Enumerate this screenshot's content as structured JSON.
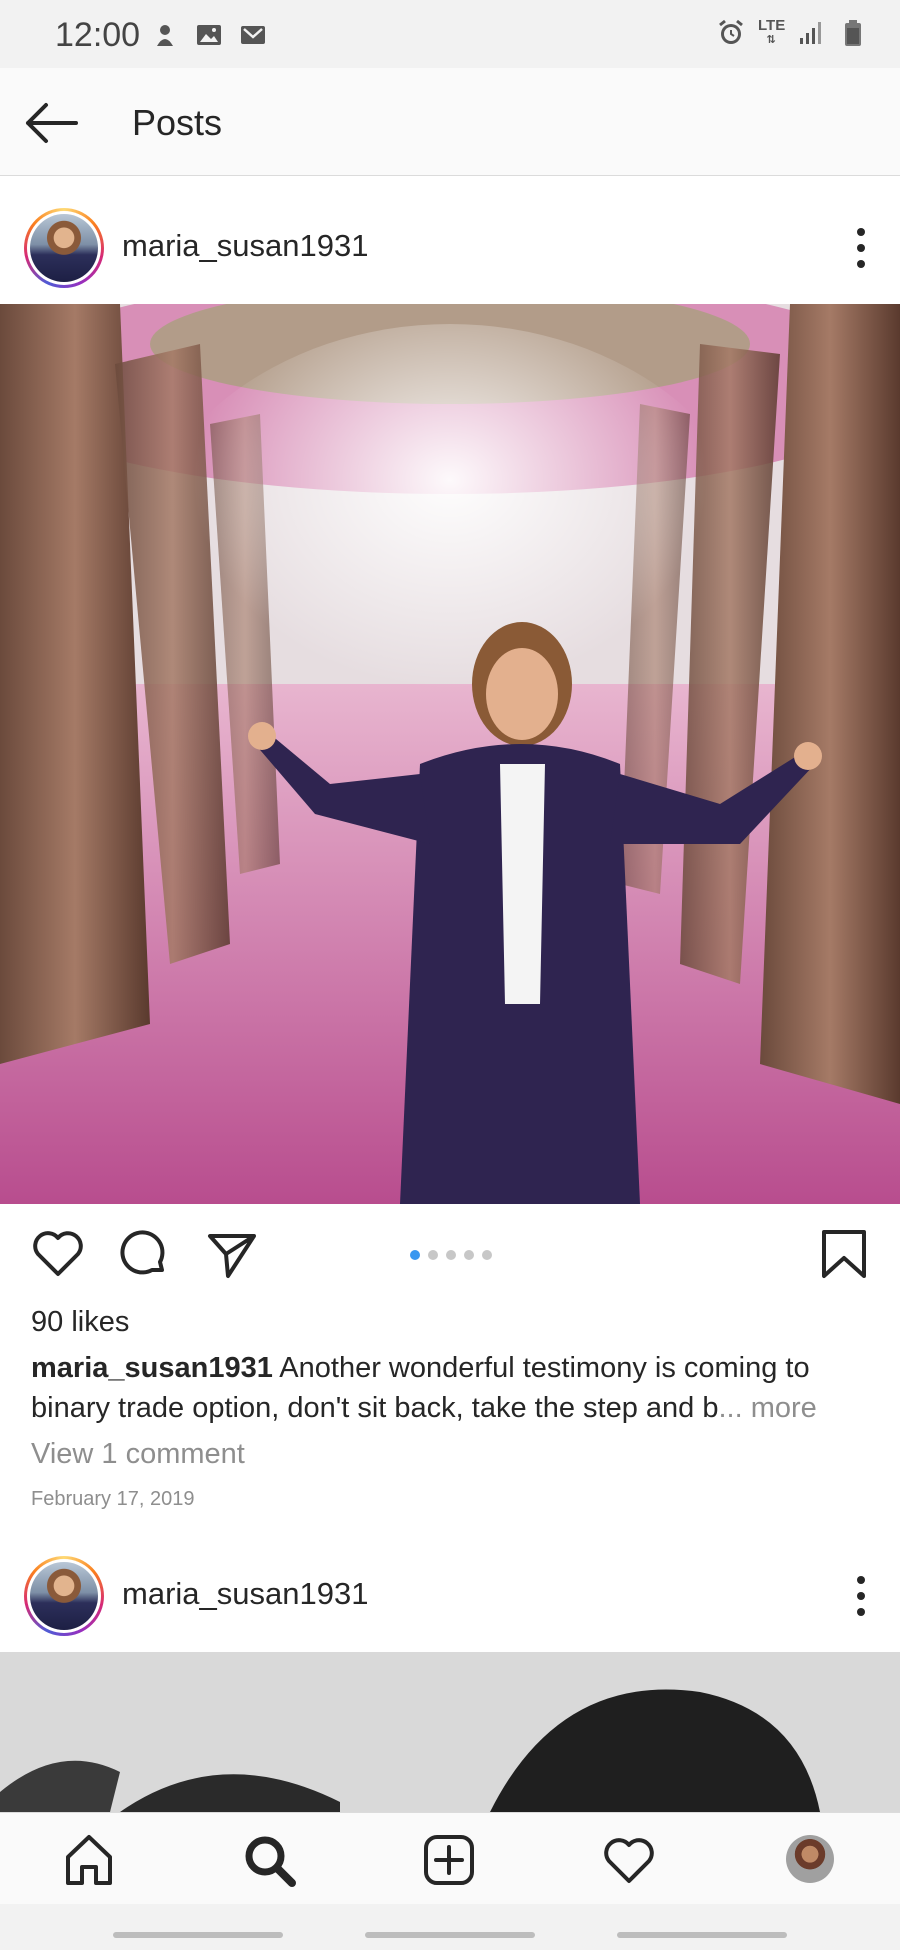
{
  "status_bar": {
    "time": "12:00",
    "network": "LTE",
    "icons_left": [
      "notification-icon",
      "gallery-icon",
      "gmail-icon"
    ],
    "icons_right": [
      "alarm-icon",
      "lte-icon",
      "signal-icon",
      "battery-icon"
    ]
  },
  "header": {
    "title": "Posts",
    "back_icon": "back-arrow-icon"
  },
  "posts": [
    {
      "username": "maria_susan1931",
      "likes": "90 likes",
      "caption_user": "maria_susan1931",
      "caption_text": " Another wonderful testimony is coming to binary trade option, don't sit back, take the step and b",
      "caption_more": "... more",
      "view_comments": "View 1 comment",
      "date": "February 17, 2019",
      "carousel": {
        "count": 5,
        "active_index": 0
      }
    },
    {
      "username": "maria_susan1931"
    }
  ],
  "bottom_nav": {
    "items": [
      "home-icon",
      "search-icon",
      "add-post-icon",
      "activity-heart-icon",
      "profile-avatar"
    ]
  },
  "colors": {
    "accent_blue": "#3897f0",
    "text": "#262626",
    "muted": "#8e8e8e"
  }
}
